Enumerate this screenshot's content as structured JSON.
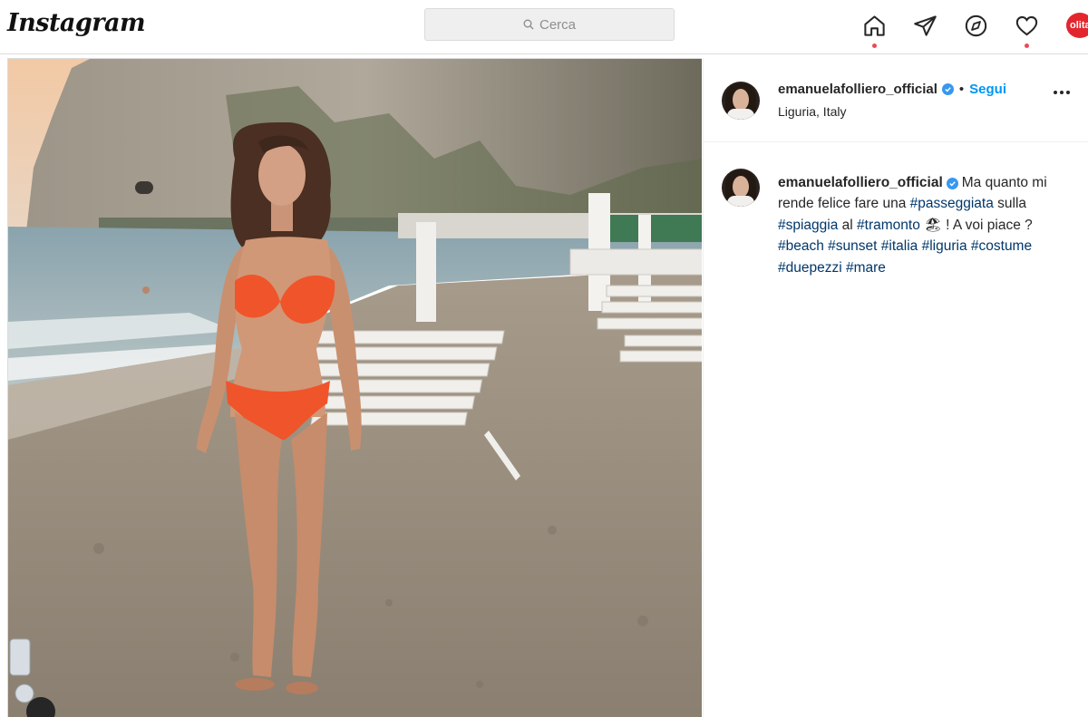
{
  "nav": {
    "logo": "Instagram",
    "search_placeholder": "Cerca",
    "icons": [
      "home-icon",
      "direct-send-icon",
      "explore-compass-icon",
      "activity-heart-icon"
    ],
    "profile_label": "olita"
  },
  "post": {
    "username": "emanuelafolliero_official",
    "separator": "•",
    "follow_label": "Segui",
    "location": "Liguria, Italy",
    "caption": {
      "username": "emanuelafolliero_official",
      "text_1": "Ma quanto mi rende felice fare una ",
      "tag_passeggiata": "#passeggiata",
      "text_2": " sulla ",
      "tag_spiaggia": "#spiaggia",
      "text_3": " al ",
      "tag_tramonto": "#tramonto",
      "text_4": " 🏖 ! A voi piace ? ",
      "tag_beach": "#beach",
      "tag_sunset": "#sunset",
      "tag_italia": "#italia",
      "tag_liguria": "#liguria",
      "tag_costume": "#costume",
      "tag_duepezzi": "#duepezzi",
      "tag_mare": "#mare"
    }
  },
  "colors": {
    "accent_blue": "#0095f6",
    "hashtag": "#00376b",
    "notification_dot": "#ed4956",
    "bikini": "#f0542a"
  }
}
